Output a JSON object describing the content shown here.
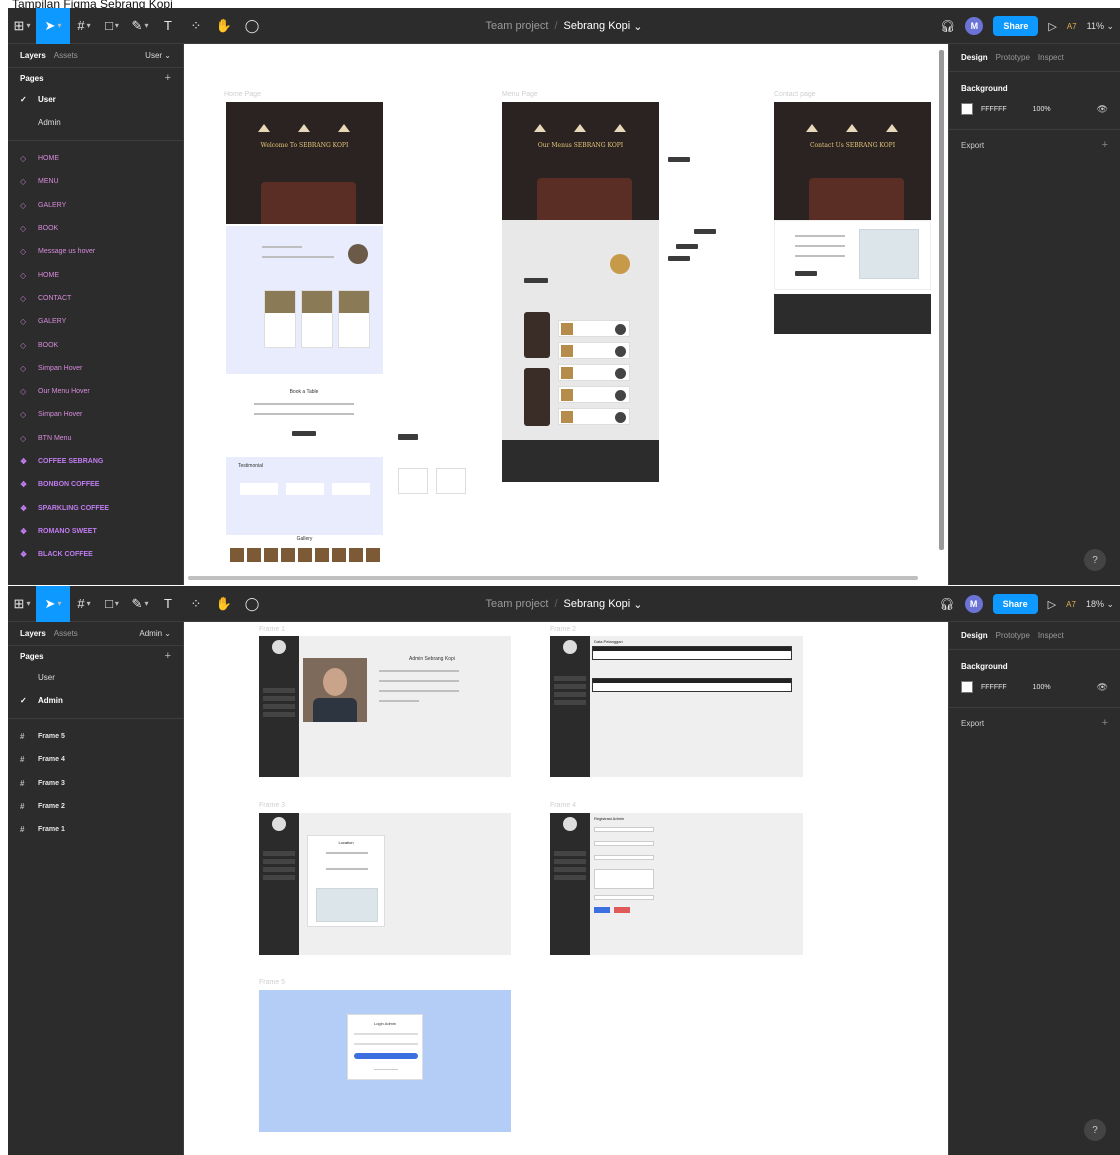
{
  "caption": "Tampilan Figma Sebrang Kopi",
  "colors": {
    "figma_dark": "#2c2c2c",
    "accent_blue": "#0d99ff",
    "component_purple": "#c07cf0",
    "hover_pink": "#d88cdc",
    "coffee_brown": "#5a2e24",
    "lavender_section": "#e8ecfc",
    "login_blue": "#b4cdf6"
  },
  "toolbar": {
    "team": "Team project",
    "separator": "/",
    "file_name": "Sebrang Kopi",
    "avatar_initial": "M",
    "share_label": "Share",
    "ai_label": "A7",
    "icons": [
      "figma-menu-icon",
      "move-tool-icon",
      "frame-tool-icon",
      "shape-tool-icon",
      "pen-tool-icon",
      "text-tool-icon",
      "resources-icon",
      "hand-tool-icon",
      "comment-icon",
      "headphones-icon",
      "play-icon"
    ]
  },
  "screen1": {
    "zoom": "11% ⌄",
    "left": {
      "tab_layers": "Layers",
      "tab_assets": "Assets",
      "page_selector": "User ⌄",
      "pages_title": "Pages",
      "pages": [
        {
          "label": "User",
          "current": true
        },
        {
          "label": "Admin",
          "current": false
        }
      ],
      "layers": [
        {
          "label": "HOME",
          "kind": "hover"
        },
        {
          "label": "MENU",
          "kind": "hover"
        },
        {
          "label": "GALERY",
          "kind": "hover"
        },
        {
          "label": "BOOK",
          "kind": "hover"
        },
        {
          "label": "Message us hover",
          "kind": "hover"
        },
        {
          "label": "HOME",
          "kind": "hover"
        },
        {
          "label": "CONTACT",
          "kind": "hover"
        },
        {
          "label": "GALERY",
          "kind": "hover"
        },
        {
          "label": "BOOK",
          "kind": "hover"
        },
        {
          "label": "Simpan Hover",
          "kind": "hover"
        },
        {
          "label": "Our Menu Hover",
          "kind": "hover"
        },
        {
          "label": "Simpan Hover",
          "kind": "hover"
        },
        {
          "label": "BTN Menu",
          "kind": "hover"
        },
        {
          "label": "COFFEE SEBRANG",
          "kind": "component"
        },
        {
          "label": "BONBON COFFEE",
          "kind": "component"
        },
        {
          "label": "SPARKLING COFFEE",
          "kind": "component"
        },
        {
          "label": "ROMANO SWEET",
          "kind": "component"
        },
        {
          "label": "BLACK COFFEE",
          "kind": "component"
        }
      ]
    },
    "canvas": {
      "frames": [
        {
          "label": "Home Page",
          "hero_title": "Welcome To SEBRANG KOPI"
        },
        {
          "label": "Menu Page",
          "hero_title": "Our Menus SEBRANG KOPI"
        },
        {
          "label": "Contact page",
          "hero_title": "Contact Us SEBRANG KOPI"
        }
      ],
      "home_sections": {
        "book_title": "Book a Table",
        "testimonial_title": "Testimonial",
        "gallery_title": "Gallery"
      }
    },
    "right": {
      "tab_design": "Design",
      "tab_prototype": "Prototype",
      "tab_inspect": "Inspect",
      "background_title": "Background",
      "bg_hex": "FFFFFF",
      "bg_opacity": "100%",
      "export_label": "Export"
    }
  },
  "screen2": {
    "zoom": "18% ⌄",
    "left": {
      "tab_layers": "Layers",
      "tab_assets": "Assets",
      "page_selector": "Admin ⌄",
      "pages_title": "Pages",
      "pages": [
        {
          "label": "User",
          "current": false
        },
        {
          "label": "Admin",
          "current": true
        }
      ],
      "frames": [
        "Frame 5",
        "Frame 4",
        "Frame 3",
        "Frame 2",
        "Frame 1"
      ]
    },
    "canvas": {
      "frames": [
        {
          "label": "Frame 1",
          "content_title": "Admin Sebrang Kopi"
        },
        {
          "label": "Frame 2",
          "content_title": "Data Pelanggan"
        },
        {
          "label": "Frame 3",
          "content_title": "Location"
        },
        {
          "label": "Frame 4",
          "content_title": "Registrasi Admin"
        },
        {
          "label": "Frame 5",
          "content_title": "Login Admin"
        }
      ]
    },
    "right": {
      "tab_design": "Design",
      "tab_prototype": "Prototype",
      "tab_inspect": "Inspect",
      "background_title": "Background",
      "bg_hex": "FFFFFF",
      "bg_opacity": "100%",
      "export_label": "Export"
    }
  }
}
